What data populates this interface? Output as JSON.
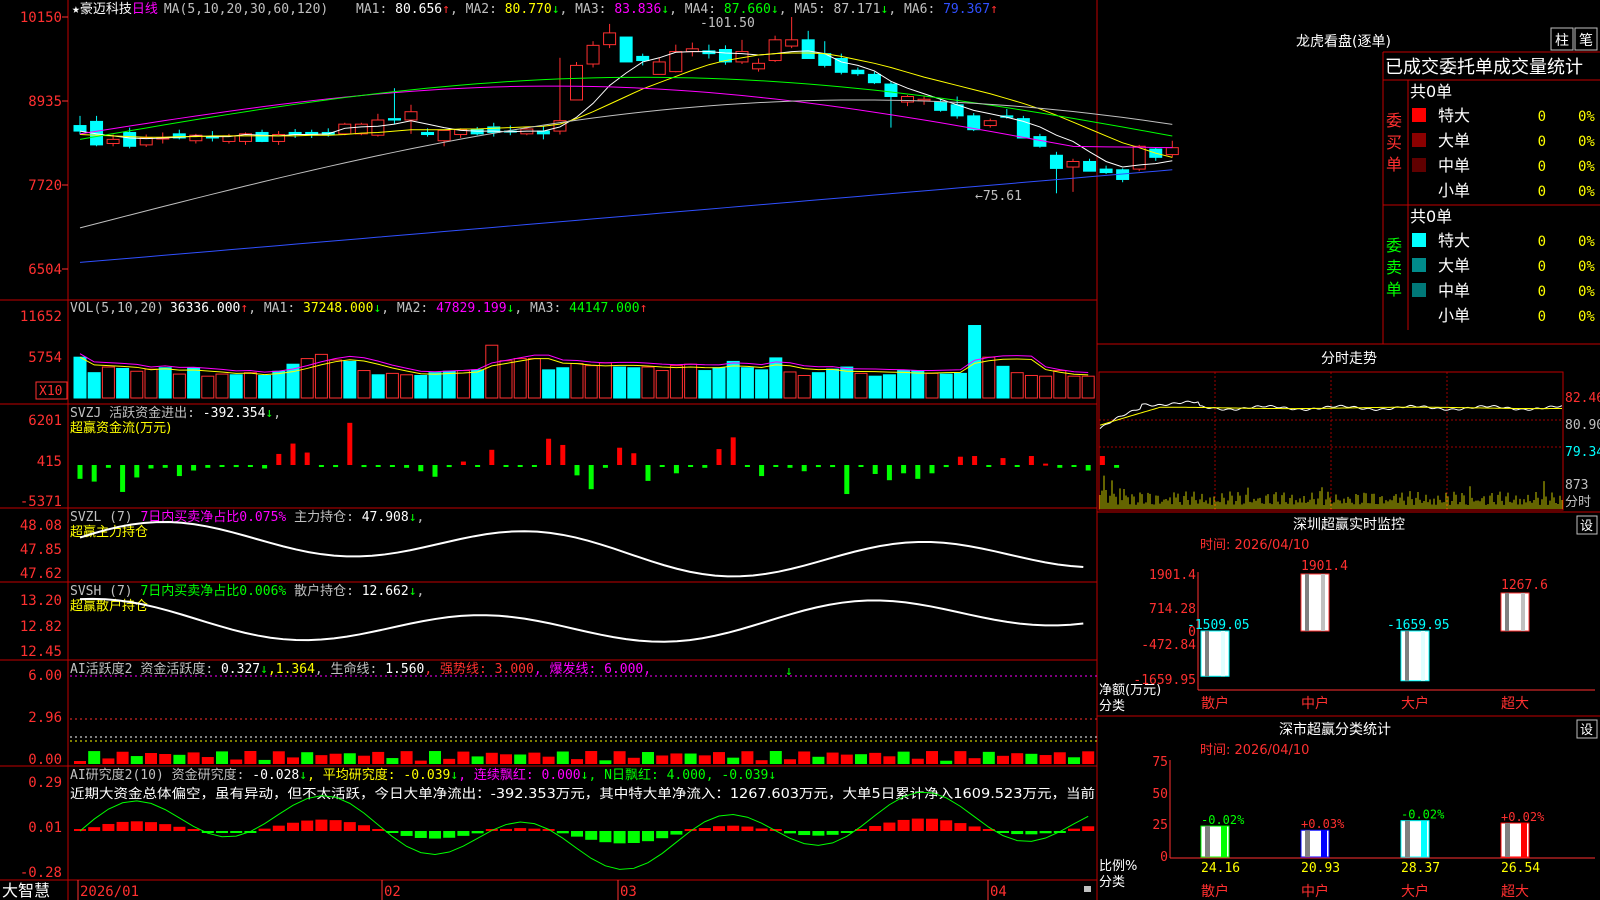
{
  "app": {
    "brand": "大智慧"
  },
  "main": {
    "header": {
      "star": "★",
      "name": "豪迈科技",
      "period": "日线",
      "ma_params": "MA(5,10,20,30,60,120)"
    },
    "ma": [
      {
        "label": "MA1: ",
        "value": "80.656",
        "arrow": "↑",
        "color": "#ffffff"
      },
      {
        "label": "MA2: ",
        "value": "80.770",
        "arrow": "↓",
        "color": "#ffff00"
      },
      {
        "label": "MA3: ",
        "value": "83.836",
        "arrow": "↓",
        "color": "#ff00ff"
      },
      {
        "label": "MA4: ",
        "value": "87.660",
        "arrow": "↓",
        "color": "#00ff00"
      },
      {
        "label": "MA5: ",
        "value": "87.171",
        "arrow": "↓",
        "color": "#c0c0c0"
      },
      {
        "label": "MA6: ",
        "value": "79.367",
        "arrow": "↑",
        "color": "#3050ff"
      }
    ],
    "high_label": "101.50",
    "low_label": "75.61",
    "yaxis": [
      "10150",
      "8935",
      "7720",
      "6504"
    ],
    "dates": [
      "2026/01",
      "02",
      "03",
      "04"
    ],
    "candles": [
      {
        "o": 85.8,
        "h": 87.2,
        "l": 84.5,
        "c": 85.0
      },
      {
        "o": 86.4,
        "h": 87.2,
        "l": 82.8,
        "c": 83.0
      },
      {
        "o": 83.2,
        "h": 84.5,
        "l": 82.8,
        "c": 83.8
      },
      {
        "o": 84.8,
        "h": 85.5,
        "l": 82.5,
        "c": 82.8
      },
      {
        "o": 83.0,
        "h": 84.5,
        "l": 82.7,
        "c": 84.0
      },
      {
        "o": 84.0,
        "h": 84.8,
        "l": 83.2,
        "c": 84.0
      },
      {
        "o": 84.6,
        "h": 85.2,
        "l": 83.8,
        "c": 84.0
      },
      {
        "o": 83.6,
        "h": 84.6,
        "l": 83.2,
        "c": 84.4
      },
      {
        "o": 84.2,
        "h": 85.0,
        "l": 83.5,
        "c": 84.0
      },
      {
        "o": 83.5,
        "h": 84.6,
        "l": 83.2,
        "c": 84.3
      },
      {
        "o": 83.5,
        "h": 84.8,
        "l": 83.0,
        "c": 84.6
      },
      {
        "o": 84.8,
        "h": 85.2,
        "l": 83.4,
        "c": 83.5
      },
      {
        "o": 83.5,
        "h": 85.0,
        "l": 83.0,
        "c": 84.5
      },
      {
        "o": 84.8,
        "h": 85.3,
        "l": 84.0,
        "c": 84.5
      },
      {
        "o": 84.8,
        "h": 85.2,
        "l": 84.0,
        "c": 84.5
      },
      {
        "o": 84.8,
        "h": 85.4,
        "l": 84.2,
        "c": 84.5
      },
      {
        "o": 84.6,
        "h": 86.2,
        "l": 84.4,
        "c": 86.0
      },
      {
        "o": 84.6,
        "h": 86.2,
        "l": 84.4,
        "c": 86.0
      },
      {
        "o": 84.4,
        "h": 87.5,
        "l": 84.2,
        "c": 86.6
      },
      {
        "o": 86.8,
        "h": 91.2,
        "l": 86.0,
        "c": 86.6
      },
      {
        "o": 86.6,
        "h": 88.8,
        "l": 84.6,
        "c": 87.8
      },
      {
        "o": 84.8,
        "h": 85.4,
        "l": 84.2,
        "c": 84.5
      },
      {
        "o": 83.6,
        "h": 85.2,
        "l": 82.8,
        "c": 85.1
      },
      {
        "o": 84.5,
        "h": 85.4,
        "l": 84.0,
        "c": 85.2
      },
      {
        "o": 85.3,
        "h": 85.6,
        "l": 84.4,
        "c": 84.6
      },
      {
        "o": 85.6,
        "h": 86.2,
        "l": 84.2,
        "c": 84.8
      },
      {
        "o": 85.0,
        "h": 85.8,
        "l": 84.4,
        "c": 84.9
      },
      {
        "o": 84.6,
        "h": 85.6,
        "l": 84.4,
        "c": 85.3
      },
      {
        "o": 85.0,
        "h": 85.7,
        "l": 83.8,
        "c": 84.6
      },
      {
        "o": 85.0,
        "h": 95.6,
        "l": 84.5,
        "c": 86.5
      },
      {
        "o": 89.5,
        "h": 95.0,
        "l": 89.5,
        "c": 94.5
      },
      {
        "o": 94.7,
        "h": 98.0,
        "l": 94.2,
        "c": 97.4
      },
      {
        "o": 97.5,
        "h": 100.5,
        "l": 97.0,
        "c": 99.2
      },
      {
        "o": 98.6,
        "h": 98.6,
        "l": 95.0,
        "c": 95.0
      },
      {
        "o": 95.8,
        "h": 96.2,
        "l": 94.5,
        "c": 95.2
      },
      {
        "o": 93.2,
        "h": 95.6,
        "l": 93.2,
        "c": 95.0
      },
      {
        "o": 93.6,
        "h": 97.5,
        "l": 93.5,
        "c": 96.5
      },
      {
        "o": 96.5,
        "h": 97.8,
        "l": 95.8,
        "c": 96.9
      },
      {
        "o": 96.6,
        "h": 97.5,
        "l": 95.5,
        "c": 96.2
      },
      {
        "o": 96.8,
        "h": 97.4,
        "l": 94.6,
        "c": 95.0
      },
      {
        "o": 95.0,
        "h": 98.2,
        "l": 94.7,
        "c": 96.5
      },
      {
        "o": 94.0,
        "h": 95.5,
        "l": 93.6,
        "c": 94.8
      },
      {
        "o": 95.2,
        "h": 98.8,
        "l": 95.0,
        "c": 98.2
      },
      {
        "o": 97.3,
        "h": 101.5,
        "l": 97.0,
        "c": 98.2
      },
      {
        "o": 98.2,
        "h": 99.5,
        "l": 95.5,
        "c": 95.5
      },
      {
        "o": 96.2,
        "h": 98.0,
        "l": 94.2,
        "c": 94.5
      },
      {
        "o": 95.5,
        "h": 96.2,
        "l": 93.2,
        "c": 93.5
      },
      {
        "o": 93.8,
        "h": 94.2,
        "l": 93.0,
        "c": 93.3
      },
      {
        "o": 93.2,
        "h": 93.6,
        "l": 91.8,
        "c": 92.0
      },
      {
        "o": 91.8,
        "h": 92.2,
        "l": 85.5,
        "c": 90.0
      },
      {
        "o": 89.2,
        "h": 90.2,
        "l": 88.6,
        "c": 90.0
      },
      {
        "o": 89.4,
        "h": 90.0,
        "l": 88.8,
        "c": 89.6
      },
      {
        "o": 89.2,
        "h": 89.6,
        "l": 87.8,
        "c": 88.0
      },
      {
        "o": 88.8,
        "h": 90.0,
        "l": 86.8,
        "c": 87.2
      },
      {
        "o": 87.2,
        "h": 87.6,
        "l": 85.0,
        "c": 85.2
      },
      {
        "o": 85.8,
        "h": 86.8,
        "l": 85.5,
        "c": 86.5
      },
      {
        "o": 87.2,
        "h": 88.2,
        "l": 86.8,
        "c": 87.0
      },
      {
        "o": 86.8,
        "h": 87.2,
        "l": 84.0,
        "c": 84.0
      },
      {
        "o": 84.2,
        "h": 84.6,
        "l": 82.6,
        "c": 82.8
      },
      {
        "o": 81.5,
        "h": 82.0,
        "l": 76.0,
        "c": 79.6
      },
      {
        "o": 79.8,
        "h": 81.0,
        "l": 76.2,
        "c": 80.6
      },
      {
        "o": 80.6,
        "h": 81.0,
        "l": 79.2,
        "c": 79.2
      },
      {
        "o": 79.5,
        "h": 80.0,
        "l": 78.8,
        "c": 79.0
      },
      {
        "o": 79.4,
        "h": 79.6,
        "l": 77.6,
        "c": 78.0
      },
      {
        "o": 79.5,
        "h": 83.0,
        "l": 79.2,
        "c": 82.8
      },
      {
        "o": 82.4,
        "h": 82.6,
        "l": 80.7,
        "c": 81.2
      },
      {
        "o": 81.6,
        "h": 83.6,
        "l": 81.2,
        "c": 82.6
      }
    ],
    "ma_lines": {
      "ma1": [
        85,
        84.6,
        84.3,
        84,
        83.9,
        84,
        84.1,
        84.3,
        84.2,
        84.2,
        84.5,
        84.4,
        84.3,
        84.5,
        84.5,
        84.6,
        85.4,
        85.6,
        85.7,
        86.0,
        86.5,
        86.0,
        85.5,
        85.1,
        85.0,
        85.0,
        84.9,
        85.0,
        85.0,
        85.6,
        87.0,
        89.0,
        91.6,
        93.4,
        95.0,
        95.6,
        96.4,
        96.5,
        96.5,
        96.3,
        96.2,
        96.0,
        96.2,
        96.5,
        96.6,
        96.2,
        95.0,
        94.5,
        93.7,
        92.2,
        91.2,
        90.4,
        89.6,
        88.8,
        88.0,
        87.5,
        87.0,
        86.4,
        85.6,
        84.4,
        83.5,
        82.0,
        80.6,
        79.8,
        80.1,
        80.3,
        80.7
      ],
      "ma2": [
        84.5,
        84.4,
        84.3,
        84.2,
        84.1,
        84.1,
        84.2,
        84.2,
        84.3,
        84.3,
        84.3,
        84.3,
        84.3,
        84.3,
        84.4,
        84.4,
        84.5,
        84.7,
        84.8,
        85.0,
        85.2,
        85.2,
        85.2,
        85.3,
        85.3,
        85.4,
        85.5,
        85.6,
        85.7,
        86.0,
        86.8,
        87.8,
        88.9,
        90.0,
        91.1,
        92.0,
        92.9,
        93.8,
        94.6,
        95.2,
        95.6,
        96.0,
        96.2,
        96.3,
        96.3,
        96.2,
        95.8,
        95.3,
        94.8,
        94.2,
        93.5,
        92.8,
        92.2,
        91.6,
        91.0,
        90.4,
        89.7,
        89.0,
        88.2,
        87.3,
        86.3,
        85.3,
        84.3,
        83.3,
        82.6,
        81.8,
        81.2
      ]
    }
  },
  "vol": {
    "title": "VOL(5,10,20)",
    "value": "36336.000",
    "arrow": "↑",
    "ma": [
      {
        "label": "MA1: ",
        "value": "37248.000",
        "arrow": "↓",
        "color": "#ffff00"
      },
      {
        "label": "MA2: ",
        "value": "47829.199",
        "arrow": "↓",
        "color": "#ff00ff"
      },
      {
        "label": "MA3: ",
        "value": "44147.000",
        "arrow": "↑",
        "color": "#00ff00"
      }
    ],
    "yaxis": [
      "11652",
      "5754"
    ],
    "unit": "X10",
    "values": [
      5800,
      3600,
      4400,
      4200,
      3800,
      4100,
      4300,
      3400,
      4300,
      3100,
      3400,
      3300,
      3600,
      3200,
      3800,
      4800,
      5600,
      6200,
      5400,
      5200,
      3900,
      3300,
      3500,
      3300,
      3200,
      3600,
      3800,
      3900,
      4000,
      7500,
      5300,
      5600,
      5600,
      4000,
      4300,
      4900,
      4600,
      5000,
      4400,
      4300,
      4400,
      3900,
      4600,
      4800,
      3900,
      4300,
      5200,
      4300,
      4000,
      5700,
      3700,
      3200,
      3600,
      4100,
      4400,
      3500,
      3100,
      3300,
      3900,
      3900,
      3500,
      3400,
      3500,
      10300,
      5800,
      4500,
      3600,
      3200,
      3100,
      3900,
      3100,
      3100
    ]
  },
  "svzj": {
    "title": "SVZJ  活跃资金进出: ",
    "value": "-392.354",
    "arrow": "↓",
    "subtitle": "超赢资金流(万元)",
    "yaxis": [
      "6201",
      "415",
      "-5371"
    ],
    "values": [
      -2000,
      -2400,
      -400,
      -3900,
      -1800,
      -500,
      -400,
      -1600,
      -800,
      -400,
      -200,
      -300,
      -200,
      -500,
      1600,
      3100,
      1800,
      -200,
      -300,
      6100,
      -300,
      -200,
      -200,
      -400,
      -900,
      -1700,
      -300,
      500,
      -200,
      2200,
      -100,
      -200,
      -200,
      3800,
      2900,
      -1500,
      -3500,
      -400,
      2500,
      1700,
      -2300,
      -100,
      -1200,
      -200,
      -400,
      2300,
      4000,
      -200,
      -1600,
      -100,
      -400,
      -900,
      -300,
      -300,
      -4200,
      -100,
      -1300,
      -2200,
      -1200,
      -2000,
      -1200,
      -300,
      1200,
      1300,
      -100,
      1000,
      -100,
      1300,
      200,
      -400,
      -200,
      -800,
      1300,
      -400
    ]
  },
  "svzl": {
    "title": "SVZL (7) ",
    "note": "7日内买卖净占比0.075%",
    "label": " 主力持仓: ",
    "value": "47.908",
    "arrow": "↓",
    "subtitle": "超赢主力持仓",
    "yaxis": [
      "48.08",
      "47.85",
      "47.62"
    ]
  },
  "svsh": {
    "title": "SVSH (7) ",
    "note": "7日内买卖净占比0.006%",
    "label": " 散户持仓: ",
    "value": "12.662",
    "arrow": "↓",
    "subtitle": "超赢散户持仓",
    "yaxis": [
      "13.20",
      "12.82",
      "12.45"
    ]
  },
  "ai1": {
    "title": "AI活跃度2 ",
    "label": "资金活跃度: ",
    "value": "0.327",
    "arrow1": "↓",
    "value2": ",1.364",
    "label2": ", 生命线: ",
    "value3": "1.560",
    "strong": ", 强势线: 3.000",
    "burst": ", 爆发线: 6.000,",
    "yaxis": [
      "6.00",
      "2.96",
      "0.00"
    ]
  },
  "ai2": {
    "title": "AI研究度2(10) ",
    "label": "资金研究度: ",
    "value": "-0.028",
    "arrow": "↓",
    "avg": ", 平均研究度: -0.039",
    "avg_arrow": "↓",
    "red": ", 连续飘红: 0.000",
    "red_arrow": "↓",
    "nred": ", N日飘红: 4.000, -0.039",
    "nred_arrow": "↓",
    "text": "近期大资金总体偏空，虽有异动，但不太活跃，今日大单净流出：-392.353万元，其中特大单净流入：1267.603万元，大单5日累计净入1609.523万元，当前",
    "yaxis": [
      "0.29",
      "0.01",
      "-0.28"
    ]
  },
  "right": {
    "lhb": {
      "title": "龙虎看盘(逐单)",
      "btn1": "柱",
      "btn2": "笔",
      "header": "已成交委托单成交量统计",
      "buy_total": "共0单",
      "buy_label": [
        "委",
        "买",
        "单"
      ],
      "sell_total": "共0单",
      "sell_label": [
        "委",
        "卖",
        "单"
      ],
      "buy_rows": [
        {
          "name": "特大",
          "v": "0",
          "p": "0%",
          "color": "#ff0000"
        },
        {
          "name": "大单",
          "v": "0",
          "p": "0%",
          "color": "#8b0000"
        },
        {
          "name": "中单",
          "v": "0",
          "p": "0%",
          "color": "#600000"
        },
        {
          "name": "小单",
          "v": "0",
          "p": "0%",
          "color": ""
        }
      ],
      "sell_rows": [
        {
          "name": "特大",
          "v": "0",
          "p": "0%",
          "color": "#00ffff"
        },
        {
          "name": "大单",
          "v": "0",
          "p": "0%",
          "color": "#008b8b"
        },
        {
          "name": "中单",
          "v": "0",
          "p": "0%",
          "color": "#007878"
        },
        {
          "name": "小单",
          "v": "0",
          "p": "0%",
          "color": ""
        }
      ]
    },
    "fenshi": {
      "title": "分时走势",
      "yaxis": [
        "82.46",
        "80.90",
        "79.34"
      ],
      "vol": "873",
      "unit": "分时"
    },
    "szjk": {
      "title": "深圳超赢实时监控",
      "settings": "设",
      "time": "时间: 2026/04/10",
      "yaxis": [
        "1901.4",
        "714.28",
        "0",
        "-472.84",
        "-1659.95"
      ],
      "ylabel": "净额(万元)",
      "xlabel": "分类",
      "bars": [
        {
          "cat": "散户",
          "value": -1509.05,
          "label": "-1509.05"
        },
        {
          "cat": "中户",
          "value": 1901.4,
          "label": "1901.4"
        },
        {
          "cat": "大户",
          "value": -1659.95,
          "label": "-1659.95"
        },
        {
          "cat": "超大",
          "value": 1267.6,
          "label": "1267.6"
        }
      ]
    },
    "fltj": {
      "title": "深市超赢分类统计",
      "settings": "设",
      "time": "时间: 2026/04/10",
      "yaxis": [
        "75",
        "50",
        "25",
        "0"
      ],
      "ylabel": "比例%",
      "xlabel": "分类",
      "bars": [
        {
          "cat": "散户",
          "value": 24.16,
          "label": "24.16",
          "chg": "-0.02%",
          "color": "#00ff00"
        },
        {
          "cat": "中户",
          "value": 20.93,
          "label": "20.93",
          "chg": "+0.03%",
          "color": "#0000ff"
        },
        {
          "cat": "大户",
          "value": 28.37,
          "label": "28.37",
          "chg": "-0.02%",
          "color": "#00ffff"
        },
        {
          "cat": "超大",
          "value": 26.54,
          "label": "26.54",
          "chg": "+0.02%",
          "color": "#ff0000"
        }
      ]
    }
  },
  "chart_data": {
    "type": "bar",
    "title": "深圳超赢实时监控",
    "categories": [
      "散户",
      "中户",
      "大户",
      "超大"
    ],
    "series": [
      {
        "name": "净额(万元)",
        "values": [
          -1509.05,
          1901.4,
          -1659.95,
          1267.6
        ]
      },
      {
        "name": "比例%",
        "values": [
          24.16,
          20.93,
          28.37,
          26.54
        ]
      }
    ]
  }
}
